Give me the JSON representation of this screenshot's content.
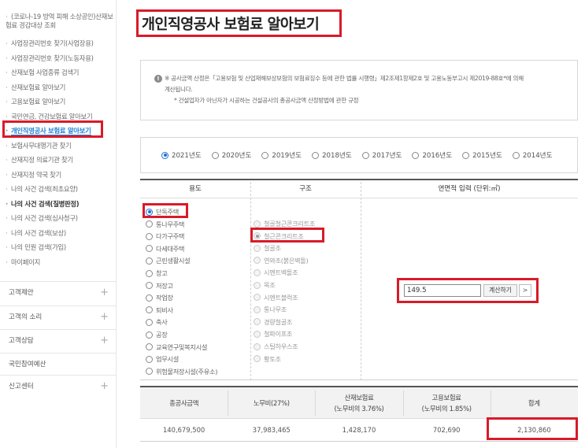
{
  "sidebar": {
    "items": [
      {
        "label": "(코로나-19 방역 피해 소상공인)산재보험료 경감대상 조회",
        "state": "normal"
      },
      {
        "label": "사업장관리번호 찾기(사업장용)",
        "state": "normal"
      },
      {
        "label": "사업장관리번호 찾기(노동자용)",
        "state": "normal"
      },
      {
        "label": "산재보험 사업종류 검색기",
        "state": "normal"
      },
      {
        "label": "산재보험료 알아보기",
        "state": "normal"
      },
      {
        "label": "고용보험료 알아보기",
        "state": "normal"
      },
      {
        "label": "국민연금, 건강보험료 알아보기",
        "state": "normal"
      },
      {
        "label": "개인직영공사 보험료 알아보기",
        "state": "active"
      },
      {
        "label": "보험사무대행기관 찾기",
        "state": "normal"
      },
      {
        "label": "산재지정 의료기관 찾기",
        "state": "normal"
      },
      {
        "label": "산재지정 약국 찾기",
        "state": "normal"
      },
      {
        "label": "나의 사건 검색(최초요양)",
        "state": "normal"
      },
      {
        "label": "나의 사건 검색(질병판정)",
        "state": "bold"
      },
      {
        "label": "나의 사건 검색(심사청구)",
        "state": "normal"
      },
      {
        "label": "나의 사건 검색(보상)",
        "state": "normal"
      },
      {
        "label": "나의 민원 검색(가입)",
        "state": "normal"
      },
      {
        "label": "마이페이지",
        "state": "normal"
      }
    ],
    "groups": [
      {
        "label": "고객제안",
        "expandable": true
      },
      {
        "label": "고객의 소리",
        "expandable": true
      },
      {
        "label": "고객상담",
        "expandable": true
      },
      {
        "label": "국민참여예산",
        "expandable": false
      },
      {
        "label": "신고센터",
        "expandable": true
      }
    ]
  },
  "page_title": "개인직영공사 보험료 알아보기",
  "notice": {
    "line1": "※ 공사금액 산정은「고용보험 및 산업재해보상보험의 보험료징수 등에 관한 법률 시행령」제2조제1항제2호 및 고용노동부고시 제2019-88호*에 의해",
    "line2": "계산됩니다.",
    "line3": "* 건설업자가 아닌자가 시공하는 건설공사의 총공사금액 산정방법에 관한 규정"
  },
  "years": [
    {
      "label": "2021년도",
      "selected": true
    },
    {
      "label": "2020년도",
      "selected": false
    },
    {
      "label": "2019년도",
      "selected": false
    },
    {
      "label": "2018년도",
      "selected": false
    },
    {
      "label": "2017년도",
      "selected": false
    },
    {
      "label": "2016년도",
      "selected": false
    },
    {
      "label": "2015년도",
      "selected": false
    },
    {
      "label": "2014년도",
      "selected": false
    }
  ],
  "form": {
    "col_usage": "용도",
    "col_structure": "구조",
    "col_area": "연면적 입력 (단위:㎡)",
    "usage_options": [
      {
        "label": "단독주택",
        "selected": true
      },
      {
        "label": "통나무주택",
        "selected": false
      },
      {
        "label": "다가구주택",
        "selected": false
      },
      {
        "label": "다세대주택",
        "selected": false
      },
      {
        "label": "근린생활시설",
        "selected": false
      },
      {
        "label": "창고",
        "selected": false
      },
      {
        "label": "저장고",
        "selected": false
      },
      {
        "label": "작업장",
        "selected": false
      },
      {
        "label": "퇴비사",
        "selected": false
      },
      {
        "label": "축사",
        "selected": false
      },
      {
        "label": "공장",
        "selected": false
      },
      {
        "label": "교육연구및복지시설",
        "selected": false
      },
      {
        "label": "업무시설",
        "selected": false
      },
      {
        "label": "위험물저장시설(주유소)",
        "selected": false
      }
    ],
    "structure_options": [
      {
        "label": "철골철근콘크리트조",
        "selected": false
      },
      {
        "label": "철근콘크리트조",
        "selected": true
      },
      {
        "label": "철골조",
        "selected": false
      },
      {
        "label": "연와조(붉은벽돌)",
        "selected": false
      },
      {
        "label": "시멘트벽돌조",
        "selected": false
      },
      {
        "label": "목조",
        "selected": false
      },
      {
        "label": "시멘트블럭조",
        "selected": false
      },
      {
        "label": "통나무조",
        "selected": false
      },
      {
        "label": "경량철골조",
        "selected": false
      },
      {
        "label": "철파이프조",
        "selected": false
      },
      {
        "label": "스틸하우스조",
        "selected": false
      },
      {
        "label": "황토조",
        "selected": false
      }
    ],
    "area_value": "149.5",
    "calc_label": "계산하기",
    "next_glyph": ">"
  },
  "result": {
    "headers": [
      {
        "l1": "총공사금액",
        "l2": ""
      },
      {
        "l1": "노무비(27%)",
        "l2": ""
      },
      {
        "l1": "산재보험료",
        "l2": "(노무비의 3.76%)"
      },
      {
        "l1": "고용보험료",
        "l2": "(노무비의 1.85%)"
      },
      {
        "l1": "합계",
        "l2": ""
      }
    ],
    "values": [
      "140,679,500",
      "37,983,465",
      "1,428,170",
      "702,690",
      "2,130,860"
    ]
  },
  "colors": {
    "highlight": "#d81b29",
    "accent": "#1f7fd0",
    "radio": "#1c6fd6"
  }
}
